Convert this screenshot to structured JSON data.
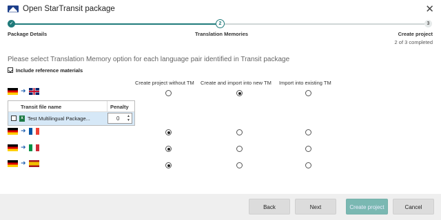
{
  "window": {
    "title": "Open StarTransit package",
    "close_icon": "close-icon"
  },
  "stepper": {
    "steps": [
      {
        "number": "1",
        "label": "Package Details",
        "state": "done"
      },
      {
        "number": "2",
        "label": "Translation Memories",
        "state": "current"
      },
      {
        "number": "3",
        "label": "Create project",
        "state": "pending"
      }
    ],
    "progress_text": "2 of 3 completed"
  },
  "content": {
    "instruction": "Please select Translation Memory option for each language pair identified in Transit package",
    "include_reference": {
      "label": "Include reference materials",
      "checked": true
    },
    "columns": [
      "Create project without TM",
      "Create and import into new TM",
      "Import into existing TM"
    ],
    "language_pairs": [
      {
        "source_flag": "german-flag-icon",
        "target_flag": "uk-flag-icon",
        "selected_option": 2
      },
      {
        "source_flag": "german-flag-icon",
        "target_flag": "france-flag-icon",
        "selected_option": 1
      },
      {
        "source_flag": "german-flag-icon",
        "target_flag": "italy-flag-icon",
        "selected_option": 1
      },
      {
        "source_flag": "german-flag-icon",
        "target_flag": "spain-flag-icon",
        "selected_option": 1
      }
    ],
    "file_table": {
      "headers": {
        "file": "Transit file name",
        "penalty": "Penalty"
      },
      "rows": [
        {
          "checked": false,
          "file": "Test Multilingual Package...",
          "penalty": "0"
        }
      ]
    }
  },
  "footer": {
    "back": "Back",
    "next": "Next",
    "create": "Create project",
    "cancel": "Cancel"
  },
  "colors": {
    "accent": "#1f7a7a",
    "create_button": "#7ab8b2",
    "footer_bg": "#efefef"
  }
}
